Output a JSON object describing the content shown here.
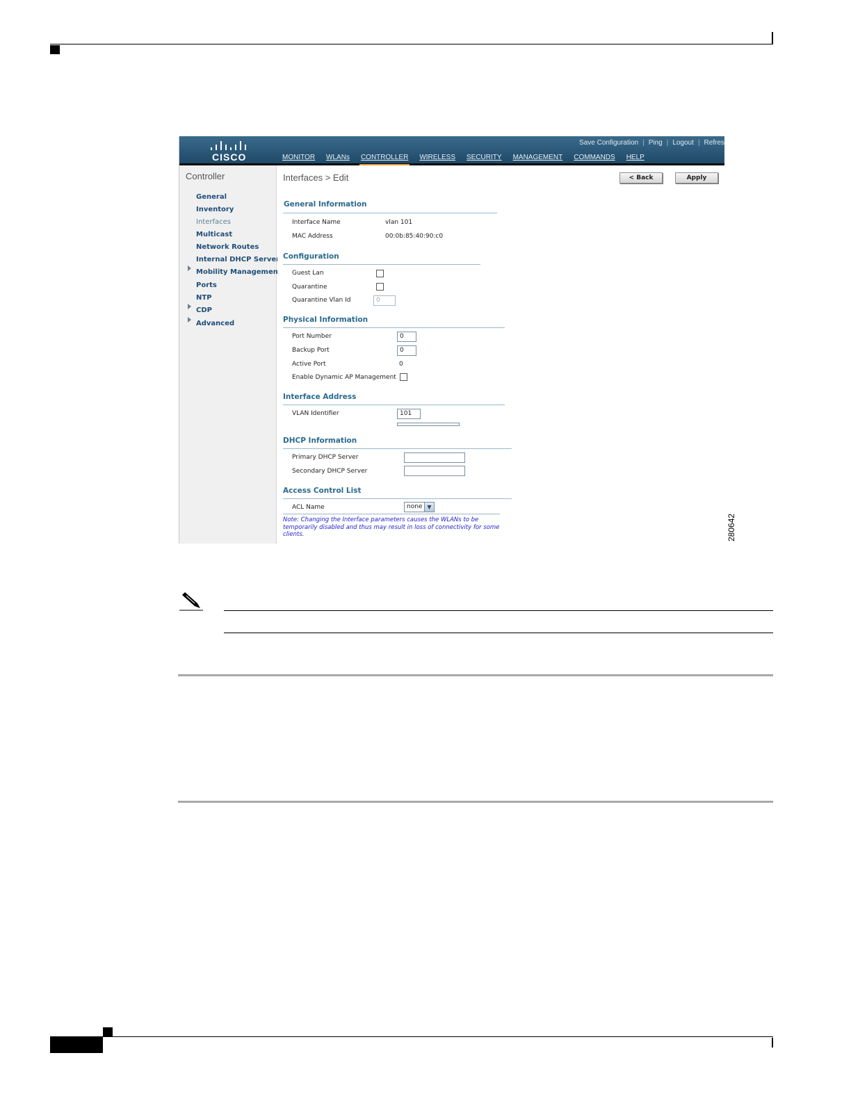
{
  "figure_id": "280642",
  "app": {
    "logo_text": "CISCO",
    "top_links": [
      "Save Configuration",
      "Ping",
      "Logout",
      "Refres"
    ],
    "nav": [
      "MONITOR",
      "WLANs",
      "CONTROLLER",
      "WIRELESS",
      "SECURITY",
      "MANAGEMENT",
      "COMMANDS",
      "HELP"
    ],
    "active_nav": "CONTROLLER"
  },
  "sidebar": {
    "title": "Controller",
    "items": [
      {
        "label": "General",
        "expandable": false,
        "current": false
      },
      {
        "label": "Inventory",
        "expandable": false,
        "current": false
      },
      {
        "label": "Interfaces",
        "expandable": false,
        "current": true
      },
      {
        "label": "Multicast",
        "expandable": false,
        "current": false
      },
      {
        "label": "Network Routes",
        "expandable": false,
        "current": false
      },
      {
        "label": "Internal DHCP Server",
        "expandable": false,
        "current": false
      },
      {
        "label": "Mobility Management",
        "expandable": true,
        "current": false
      },
      {
        "label": "Ports",
        "expandable": false,
        "current": false
      },
      {
        "label": "NTP",
        "expandable": false,
        "current": false
      },
      {
        "label": "CDP",
        "expandable": true,
        "current": false
      },
      {
        "label": "Advanced",
        "expandable": true,
        "current": false
      }
    ]
  },
  "content": {
    "title": "Interfaces > Edit",
    "back_label": "< Back",
    "apply_label": "Apply",
    "general": {
      "heading": "General Information",
      "interface_name_label": "Interface Name",
      "interface_name_value": "vlan 101",
      "mac_label": "MAC Address",
      "mac_value": "00:0b:85:40:90:c0"
    },
    "configuration": {
      "heading": "Configuration",
      "guest_lan_label": "Guest Lan",
      "quarantine_label": "Quarantine",
      "quarantine_vlan_label": "Quarantine Vlan Id",
      "quarantine_vlan_value": "0"
    },
    "physical": {
      "heading": "Physical Information",
      "port_number_label": "Port Number",
      "port_number_value": "0",
      "backup_port_label": "Backup Port",
      "backup_port_value": "0",
      "active_port_label": "Active Port",
      "active_port_value": "0",
      "dynamic_ap_label": "Enable Dynamic AP Management"
    },
    "address": {
      "heading": "Interface Address",
      "vlan_id_label": "VLAN Identifier",
      "vlan_id_value": "101"
    },
    "dhcp": {
      "heading": "DHCP Information",
      "primary_label": "Primary DHCP Server",
      "primary_value": "",
      "secondary_label": "Secondary DHCP Server",
      "secondary_value": ""
    },
    "acl": {
      "heading": "Access Control List",
      "acl_label": "ACL Name",
      "acl_value": "none"
    },
    "note": "Note: Changing the Interface parameters causes the WLANs to be temporarily disabled and thus may result in loss of connectivity for some clients."
  }
}
